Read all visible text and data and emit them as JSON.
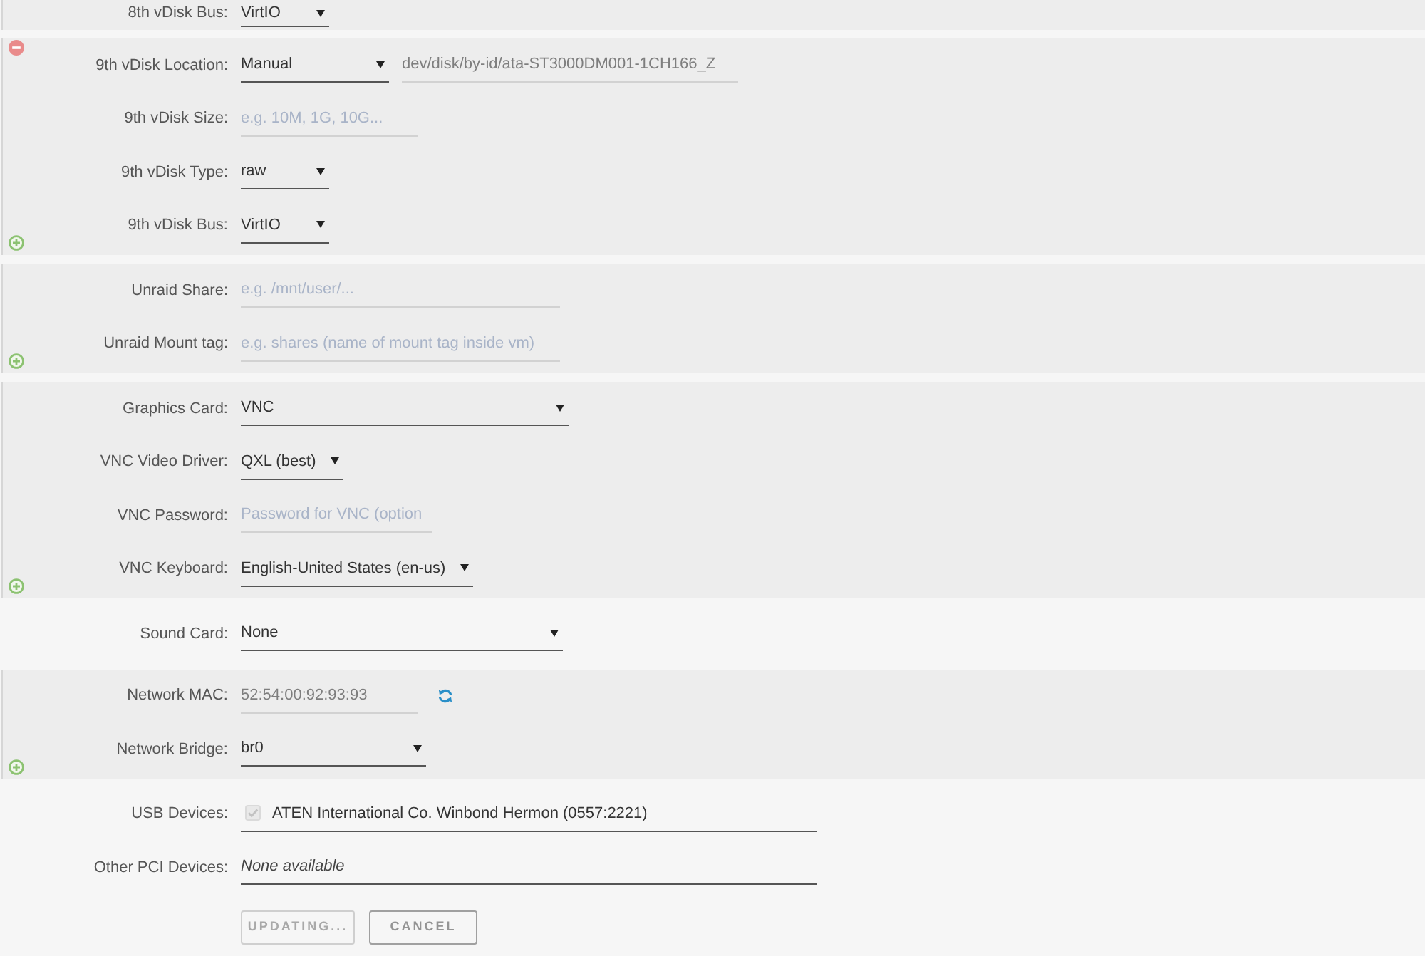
{
  "sections": [
    {
      "shaded": true,
      "rows": [
        {
          "label": "8th vDisk Bus:",
          "controls": [
            {
              "kind": "select",
              "value": "VirtIO"
            }
          ]
        }
      ]
    },
    {
      "shaded": true,
      "remove_button": true,
      "add_button": true,
      "rows": [
        {
          "label": "9th vDisk Location:",
          "controls": [
            {
              "kind": "select",
              "value": "Manual"
            },
            {
              "kind": "input",
              "value": "dev/disk/by-id/ata-ST3000DM001-1CH166_Z"
            }
          ]
        },
        {
          "label": "9th vDisk Size:",
          "controls": [
            {
              "kind": "input",
              "placeholder": "e.g. 10M, 1G, 10G..."
            }
          ]
        },
        {
          "label": "9th vDisk Type:",
          "controls": [
            {
              "kind": "select",
              "value": "raw"
            }
          ]
        },
        {
          "label": "9th vDisk Bus:",
          "controls": [
            {
              "kind": "select",
              "value": "VirtIO"
            }
          ]
        }
      ]
    },
    {
      "shaded": true,
      "add_button": true,
      "rows": [
        {
          "label": "Unraid Share:",
          "controls": [
            {
              "kind": "input",
              "placeholder": "e.g. /mnt/user/..."
            }
          ]
        },
        {
          "label": "Unraid Mount tag:",
          "controls": [
            {
              "kind": "input",
              "placeholder": "e.g. shares (name of mount tag inside vm)"
            }
          ]
        }
      ]
    },
    {
      "shaded": true,
      "add_button": true,
      "rows": [
        {
          "label": "Graphics Card:",
          "controls": [
            {
              "kind": "select",
              "value": "VNC"
            }
          ]
        },
        {
          "label": "VNC Video Driver:",
          "controls": [
            {
              "kind": "select",
              "value": "QXL (best)"
            }
          ]
        },
        {
          "label": "VNC Password:",
          "controls": [
            {
              "kind": "input",
              "placeholder": "Password for VNC (option"
            }
          ]
        },
        {
          "label": "VNC Keyboard:",
          "controls": [
            {
              "kind": "select",
              "value": "English-United States (en-us)"
            }
          ]
        }
      ]
    },
    {
      "shaded": false,
      "rows": [
        {
          "label": "Sound Card:",
          "controls": [
            {
              "kind": "select",
              "value": "None"
            }
          ]
        }
      ]
    },
    {
      "shaded": true,
      "add_button": true,
      "rows": [
        {
          "label": "Network MAC:",
          "controls": [
            {
              "kind": "input",
              "value": "52:54:00:92:93:93"
            },
            {
              "kind": "icon_button"
            }
          ]
        },
        {
          "label": "Network Bridge:",
          "controls": [
            {
              "kind": "select",
              "value": "br0"
            }
          ]
        }
      ]
    },
    {
      "shaded": false,
      "rows": [
        {
          "label": "USB Devices:",
          "controls": [
            {
              "kind": "checkboxes",
              "items": [
                {
                  "label": "ATEN International Co. Winbond Hermon (0557:2221)",
                  "checked": true,
                  "disabled": true
                }
              ]
            }
          ]
        },
        {
          "label": "Other PCI Devices:",
          "controls": [
            {
              "kind": "note",
              "text": "None available"
            }
          ]
        }
      ]
    }
  ],
  "buttons": [
    {
      "label": "UPDATING...",
      "disabled": true
    },
    {
      "label": "CANCEL",
      "disabled": false
    }
  ]
}
